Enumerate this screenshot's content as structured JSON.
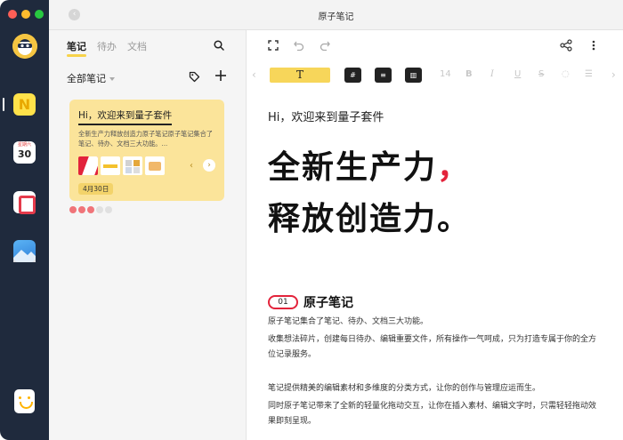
{
  "window": {
    "title": "原子笔记"
  },
  "dock": {
    "calendar": {
      "month": "星期六",
      "day": "30"
    },
    "app_n_letter": "N"
  },
  "list": {
    "tabs": [
      {
        "label": "笔记",
        "active": true
      },
      {
        "label": "待办",
        "active": false
      },
      {
        "label": "文档",
        "active": false
      }
    ],
    "folder": "全部笔记",
    "card": {
      "title": "Hi，欢迎来到量子套件",
      "body": "全新生产力释放创造力原子笔记原子笔记集合了笔记、待办、文档三大功能。...",
      "date": "4月30日",
      "pager": {
        "total": 5,
        "active": 3
      }
    }
  },
  "editor": {
    "toolbar": {
      "text_style": "T",
      "font_size": "14",
      "bold": "B",
      "italic": "I",
      "underline": "U",
      "strike": "S"
    },
    "doc": {
      "subtitle": "Hi，欢迎来到量子套件",
      "headline_line1": "全新生产力",
      "headline_mark": "，",
      "headline_line2": "释放创造力。",
      "section_number": "01",
      "section_title": "原子笔记",
      "paragraphs": [
        "原子笔记集合了笔记、待办、文档三大功能。",
        "收集想法碎片，创建每日待办、编辑重要文件，所有操作一气呵成，只为打造专属于你的全方位记录服务。",
        "笔记提供精美的编辑素材和多维度的分类方式，让你的创作与管理应运而生。",
        "同时原子笔记带来了全新的轻量化拖动交互，让你在插入素材、编辑文字时，只需轻轻拖动效果即刻呈现。"
      ]
    }
  },
  "colors": {
    "accent_yellow": "#f7d65a",
    "card_yellow": "#fbe49a",
    "accent_red": "#e3233b",
    "dock_bg": "#1f2a3d"
  },
  "icons": {
    "search": "search-icon",
    "tag": "tag-icon",
    "add": "plus-icon",
    "fullscreen": "expand-icon",
    "undo": "undo-icon",
    "redo": "redo-icon",
    "share": "share-icon",
    "more": "more-vertical-icon"
  }
}
